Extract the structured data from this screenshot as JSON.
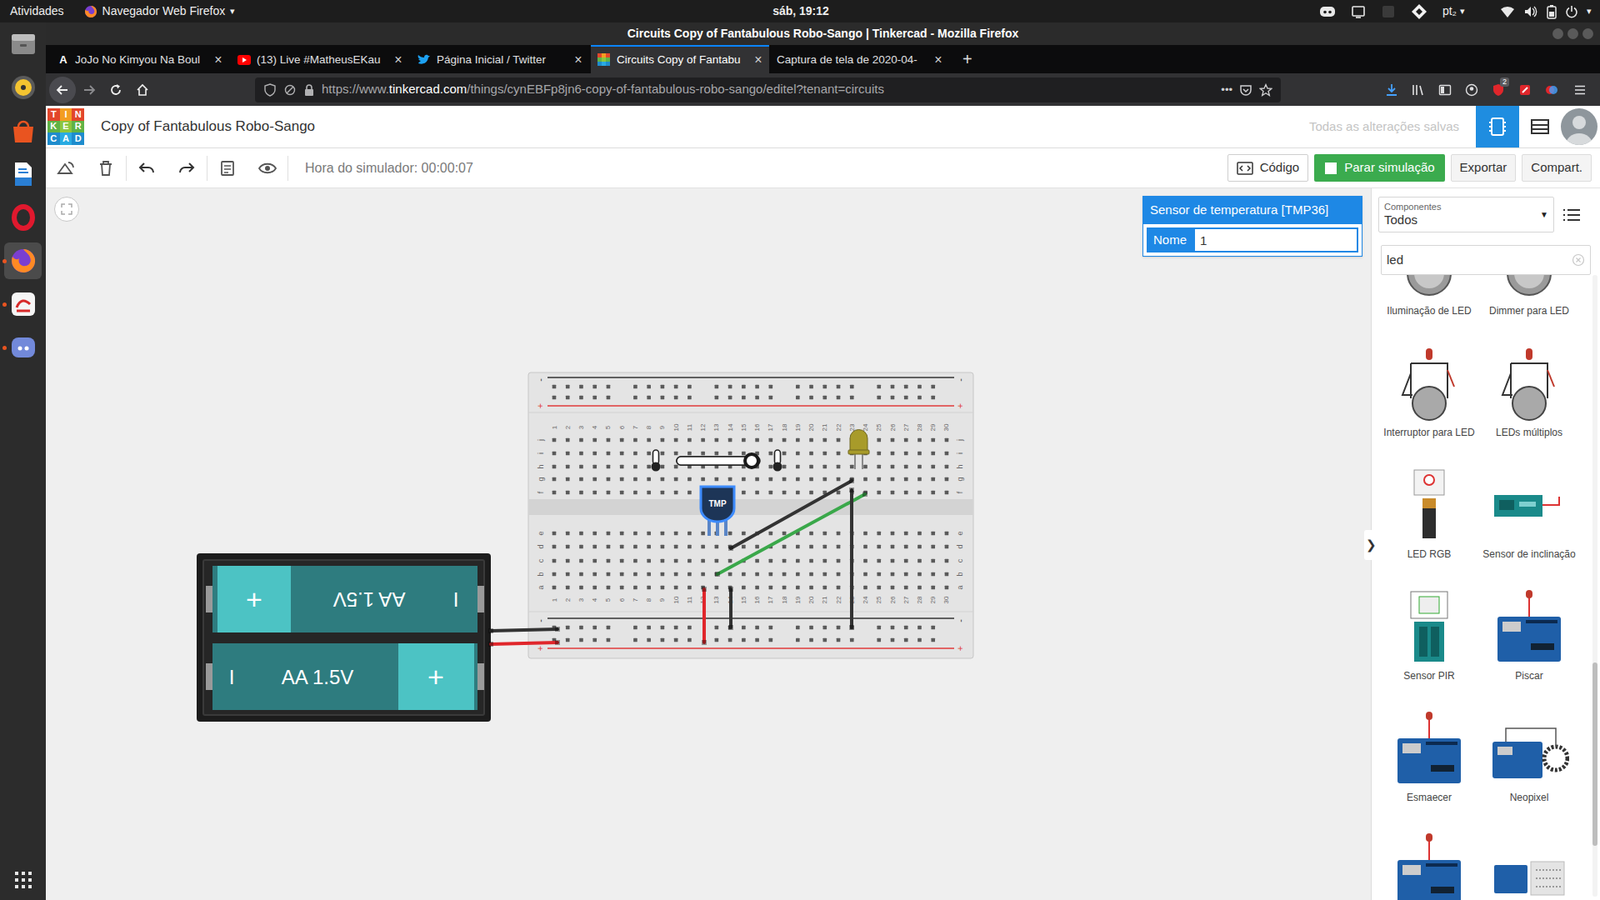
{
  "topbar": {
    "activities": "Atividades",
    "app": "Navegador Web Firefox",
    "app_arrow": "▾",
    "clock": "sáb, 19:12",
    "keyboard": "pt₂",
    "keyboard_arrow": "▾",
    "system_arrow": "▾"
  },
  "dock": [
    {
      "kind": "files",
      "running": false,
      "active": false
    },
    {
      "kind": "music",
      "running": false,
      "active": false
    },
    {
      "kind": "software",
      "running": false,
      "active": false
    },
    {
      "kind": "writer",
      "running": false,
      "active": false
    },
    {
      "kind": "opera",
      "running": false,
      "active": false
    },
    {
      "kind": "firefox",
      "running": true,
      "active": true
    },
    {
      "kind": "screenshot",
      "running": true,
      "active": false
    },
    {
      "kind": "discord",
      "running": true,
      "active": false
    }
  ],
  "window": {
    "title": "Circuits Copy of Fantabulous Robo-Sango | Tinkercad - Mozilla Firefox"
  },
  "tabs": [
    {
      "label": "JoJo No Kimyou Na Boul",
      "favicon": "A",
      "kind": "letter",
      "selected": false,
      "close": "×"
    },
    {
      "label": "(13) Live #MatheusEKau",
      "kind": "youtube",
      "selected": false,
      "close": "×"
    },
    {
      "label": "Página Inicial / Twitter",
      "kind": "twitter",
      "selected": false,
      "close": "×"
    },
    {
      "label": "Circuits Copy of Fantabu",
      "kind": "tinkercad",
      "selected": true,
      "close": "×"
    },
    {
      "label": "Captura de tela de 2020-04-",
      "kind": "none",
      "selected": false,
      "close": "×"
    }
  ],
  "new_tab": "+",
  "address_bar": {
    "prefix": "https://www.",
    "domain": "tinkercad.com",
    "path": "/things/cynEBFp8jn6-copy-of-fantabulous-robo-sango/editel?tenant=circuits",
    "more": "•••"
  },
  "extension_badge": "2",
  "app_header": {
    "logo": [
      "T",
      "I",
      "N",
      "K",
      "E",
      "R",
      "C",
      "A",
      "D"
    ],
    "title": "Copy of Fantabulous Robo-Sango",
    "save_status": "Todas as alterações salvas"
  },
  "sim_toolbar": {
    "time": "Hora do simulador: 00:00:07",
    "buttons": [
      {
        "label": "Código",
        "kind": "code"
      },
      {
        "label": "Parar simulação",
        "kind": "primary"
      },
      {
        "label": "Exportar",
        "kind": "plain"
      },
      {
        "label": "Compart.",
        "kind": "plain"
      }
    ]
  },
  "inspector": {
    "title": "Sensor de temperatura [TMP36]",
    "field_label": "Nome",
    "field_value": "1"
  },
  "components_panel": {
    "filter_label": "Componentes",
    "filter_value": "Todos",
    "filter_arrow": "▼",
    "search": "led",
    "collapse": "❯",
    "items": [
      {
        "label": "Iluminação de LED",
        "kind": "motor"
      },
      {
        "label": "Dimmer para LED",
        "kind": "motor"
      },
      {
        "label": "Interruptor para LED",
        "kind": "led-circuit"
      },
      {
        "label": "LEDs múltiplos",
        "kind": "led-circuit"
      },
      {
        "label": "LED RGB",
        "kind": "battery-led"
      },
      {
        "label": "Sensor de inclinação",
        "kind": "module"
      },
      {
        "label": "Sensor PIR",
        "kind": "pir"
      },
      {
        "label": "Piscar",
        "kind": "arduino"
      },
      {
        "label": "Esmaecer",
        "kind": "arduino"
      },
      {
        "label": "Neopixel",
        "kind": "arduino-ring"
      },
      {
        "kind": "arduino"
      },
      {
        "kind": "breadboard-small"
      }
    ]
  },
  "breadboard": {
    "columns": [
      "1",
      "2",
      "3",
      "4",
      "5",
      "6",
      "7",
      "8",
      "9",
      "10",
      "11",
      "12",
      "13",
      "14",
      "15",
      "16",
      "17",
      "18",
      "19",
      "20",
      "21",
      "22",
      "23",
      "24",
      "25",
      "26",
      "27",
      "28",
      "29",
      "30"
    ],
    "rows_top": [
      "j",
      "i",
      "h",
      "g",
      "f"
    ],
    "rows_bottom": [
      "e",
      "d",
      "c",
      "b",
      "a"
    ],
    "rail_minus": "-",
    "rail_plus": "+"
  },
  "parts": {
    "tmp_label": "TMP",
    "tmp_selected": true,
    "temperature_level": 0.9,
    "led": {
      "lit": false,
      "color": "#a89b2a"
    }
  },
  "wires": [
    {
      "color": "#333333"
    },
    {
      "color": "#3aa84a"
    },
    {
      "color": "#333333"
    },
    {
      "color": "#e0262b"
    },
    {
      "color": "#333333"
    },
    {
      "color": "#333333"
    },
    {
      "color": "#e0262b"
    }
  ],
  "battery": {
    "cells": [
      {
        "label": "AA 1.5V",
        "plus": "+",
        "minus": "I",
        "flipped": true
      },
      {
        "label": "AA 1.5V",
        "plus": "+",
        "minus": "I",
        "flipped": false
      }
    ]
  }
}
